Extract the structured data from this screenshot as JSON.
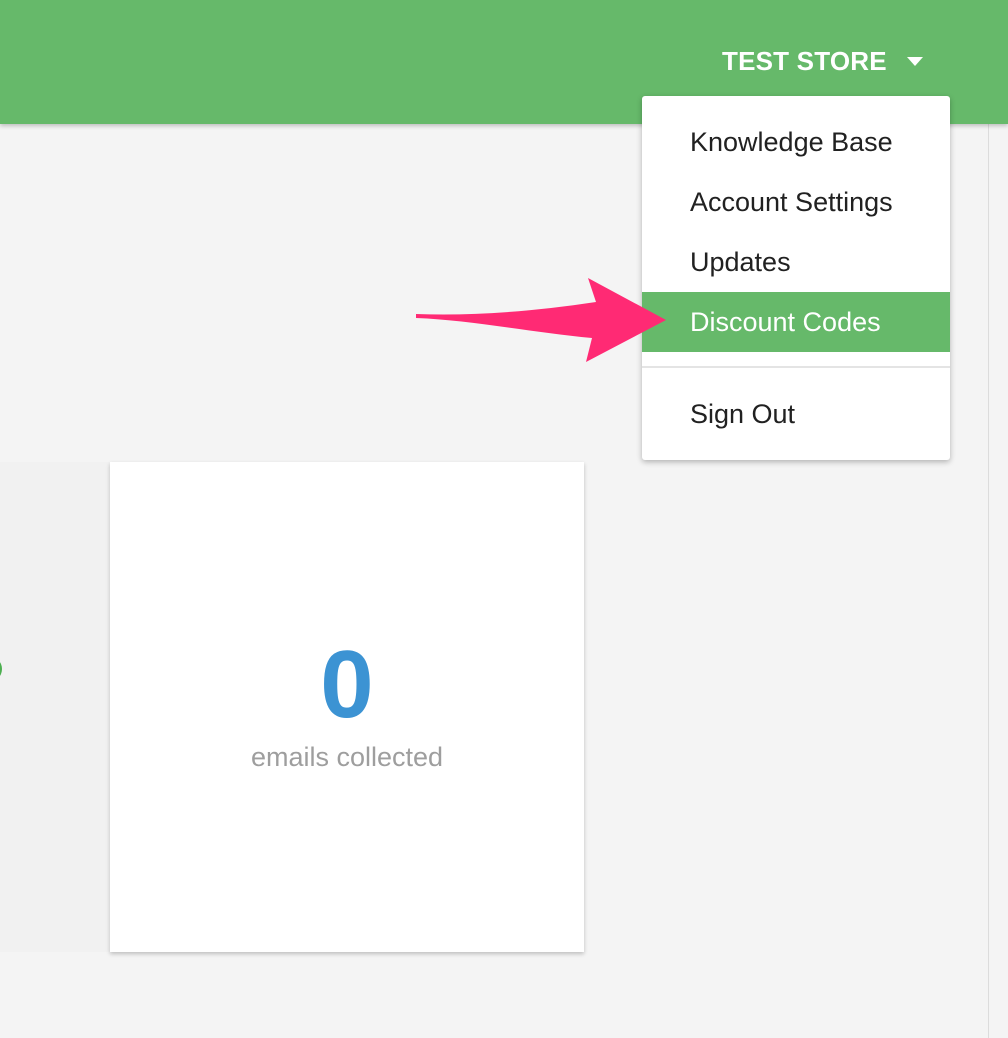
{
  "header": {
    "store_name": "TEST STORE",
    "accent_color": "#66b96a"
  },
  "dropdown": {
    "items": [
      {
        "label": "Knowledge Base"
      },
      {
        "label": "Account Settings"
      },
      {
        "label": "Updates"
      },
      {
        "label": "Discount Codes",
        "selected": true
      },
      {
        "label": "Sign Out"
      }
    ]
  },
  "stats": {
    "emails_collected": {
      "value": "0",
      "label": "emails collected",
      "color": "#3c93d3"
    }
  },
  "annotation": {
    "arrow_color": "#ff2a74",
    "icon": "pointer-arrow"
  }
}
